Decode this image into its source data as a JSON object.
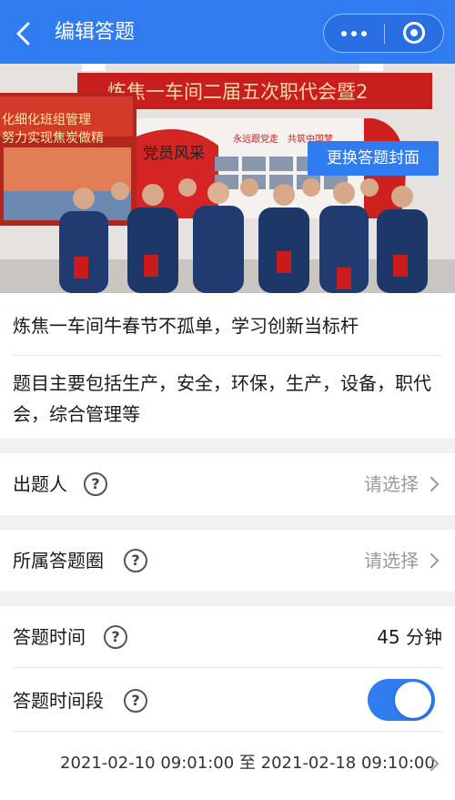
{
  "navbar": {
    "title": "编辑答题",
    "back_icon": "chevron-left-icon",
    "more_icon": "more-dots-icon",
    "close_icon": "target-circle-icon",
    "color": "#2f7bf0"
  },
  "cover": {
    "change_cover_label": "更换答题封面",
    "banner_text": "炼焦一车间二届五次职代会暨2",
    "side_banner_text": [
      "化细化班组管理",
      "努力实现焦炭做精"
    ],
    "panel_heading": "党员风采",
    "panel_slogans": [
      "永远跟党走",
      "共筑中国梦"
    ]
  },
  "intro": {
    "title": "炼焦一车间牛春节不孤单，学习创新当标杆",
    "description": "题目主要包括生产，安全，环保，生产，设备，职代会，综合管理等"
  },
  "question_setter": {
    "label": "出题人",
    "help_glyph": "?",
    "placeholder": "请选择"
  },
  "quiz_circle": {
    "label": "所属答题圈",
    "help_glyph": "?",
    "placeholder": "请选择"
  },
  "quiz_time": {
    "label": "答题时间",
    "help_glyph": "?",
    "value": "45 分钟"
  },
  "time_range": {
    "label": "答题时间段",
    "help_glyph": "?",
    "enabled": true,
    "range_text": "2021-02-10 09:01:00 至 2021-02-18 09:10:00"
  }
}
